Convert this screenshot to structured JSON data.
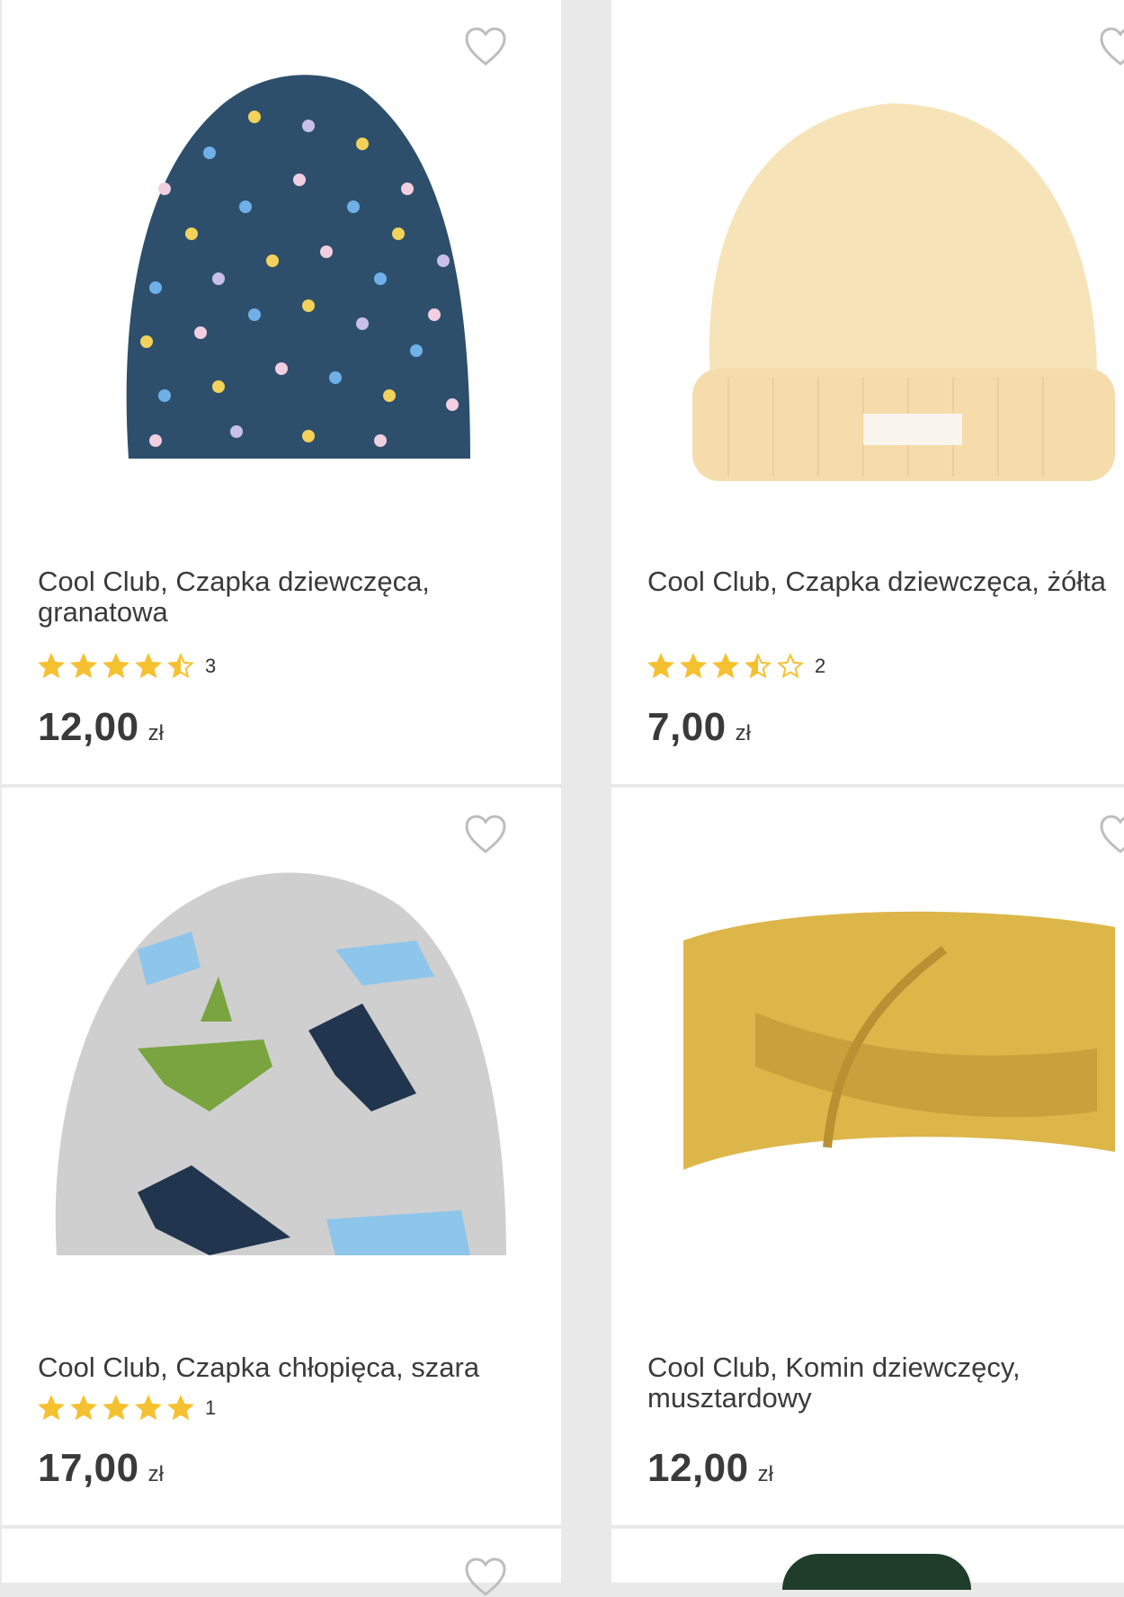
{
  "products": [
    {
      "title": "Cool Club, Czapka dziewczęca, granatowa",
      "rating": 4.5,
      "rating_count": "3",
      "price": "12,00",
      "currency": "zł",
      "image": "navy-polka-dot-beanie",
      "colors": {
        "main": "#2e4f6b"
      }
    },
    {
      "title": "Cool Club, Czapka dziewczęca, żółta",
      "rating": 3.5,
      "rating_count": "2",
      "price": "7,00",
      "currency": "zł",
      "image": "yellow-ribbed-hat",
      "colors": {
        "main": "#f6dfae"
      }
    },
    {
      "title": "Cool Club, Czapka chłopięca, szara",
      "rating": 5,
      "rating_count": "1",
      "price": "17,00",
      "currency": "zł",
      "image": "grey-dinosaur-beanie",
      "colors": {
        "main": "#cfcfcf"
      }
    },
    {
      "title": "Cool Club, Komin dziewczęcy, musztardowy",
      "price": "12,00",
      "currency": "zł",
      "image": "mustard-knit-headband",
      "colors": {
        "main": "#ddb64a"
      }
    }
  ],
  "icons": {
    "favorite": "heart-outline-icon",
    "star": "star-icon"
  },
  "accent_star_color": "#f5c130"
}
